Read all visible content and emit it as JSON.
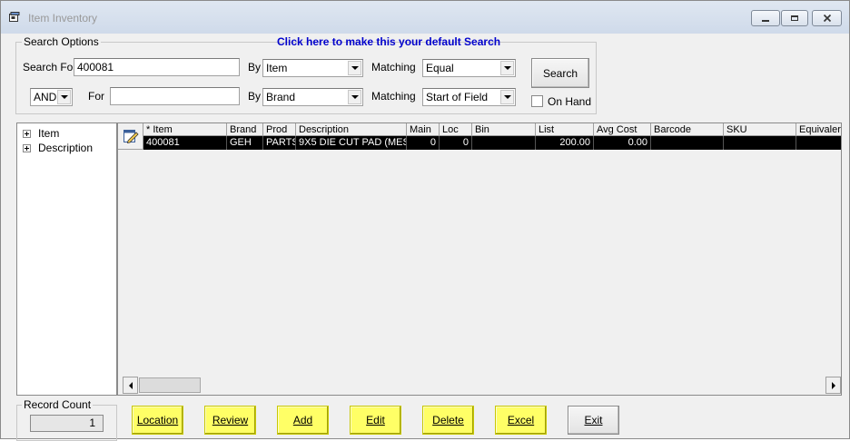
{
  "window": {
    "title": "Item Inventory"
  },
  "search_options": {
    "legend": "Search Options",
    "default_link": "Click here to make this your default Search",
    "row1": {
      "label": "Search For",
      "value": "400081",
      "by_label": "By",
      "by_value": "Item",
      "matching_label": "Matching",
      "matching_value": "Equal"
    },
    "row2": {
      "conjunction": "AND",
      "label": "For",
      "value": "",
      "by_label": "By",
      "by_value": "Brand",
      "matching_label": "Matching",
      "matching_value": "Start of Field"
    },
    "search_button": "Search",
    "on_hand_label": "On Hand",
    "on_hand_checked": false
  },
  "tree": {
    "nodes": [
      {
        "label": "Item"
      },
      {
        "label": "Description"
      }
    ]
  },
  "grid": {
    "columns": [
      "* Item",
      "Brand",
      "Prod",
      "Description",
      "Main",
      "Loc",
      "Bin",
      "List",
      "Avg Cost",
      "Barcode",
      "SKU",
      "Equivaler"
    ],
    "rows": [
      {
        "item": "400081",
        "brand": "GEH",
        "prod": "PARTS",
        "description": "9X5 DIE CUT PAD (MES",
        "main": "0",
        "loc": "0",
        "bin": "",
        "list": "200.00",
        "avg_cost": "0.00",
        "barcode": "",
        "sku": "",
        "equivalent": ""
      }
    ]
  },
  "record_count": {
    "label": "Record Count",
    "value": "1"
  },
  "buttons": {
    "location": "Location",
    "review": "Review",
    "add": "Add",
    "edit": "Edit",
    "delete": "Delete",
    "excel": "Excel",
    "exit": "Exit"
  },
  "colors": {
    "highlight_button": "#ffff66",
    "selected_row": "#000000",
    "link": "#0000cc"
  }
}
